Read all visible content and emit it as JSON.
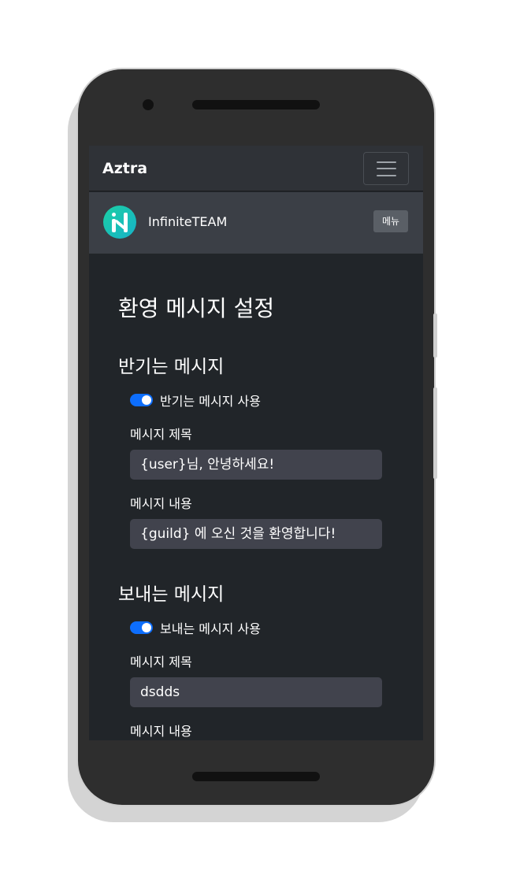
{
  "navbar": {
    "brand": "Aztra"
  },
  "guild": {
    "name": "InfiniteTEAM",
    "menu_label": "메뉴"
  },
  "page": {
    "title": "환영 메시지 설정"
  },
  "join_section": {
    "title": "반기는 메시지",
    "toggle_label": "반기는 메시지 사용",
    "toggle_on": true,
    "title_label": "메시지 제목",
    "title_value": "{user}님, 안녕하세요!",
    "content_label": "메시지 내용",
    "content_value": "{guild} 에 오신 것을 환영합니다!"
  },
  "leave_section": {
    "title": "보내는 메시지",
    "toggle_label": "보내는 메시지 사용",
    "toggle_on": true,
    "title_label": "메시지 제목",
    "title_value": "dsdds",
    "content_label": "메시지 내용"
  },
  "colors": {
    "background": "#212529",
    "navbar": "#2f3237",
    "guild_bar": "#3b3f46",
    "input": "#41434d",
    "switch_accent": "#0d6efd",
    "avatar_gradient_start": "#1bcfa4",
    "avatar_gradient_end": "#17b2c8"
  }
}
